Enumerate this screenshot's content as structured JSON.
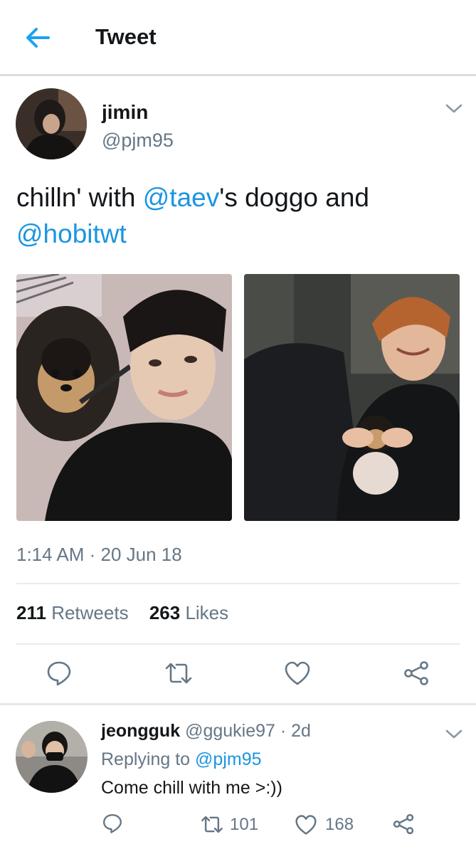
{
  "header": {
    "title": "Tweet"
  },
  "tweet": {
    "author_name": "jimin",
    "author_handle": "@pjm95",
    "text_part1": "chilln' with ",
    "mention1": "@taev",
    "text_part2": "'s doggo and ",
    "mention2": "@hobitwt",
    "timestamp": "1:14 AM · 20 Jun 18",
    "retweets_count": "211",
    "retweets_label": "Retweets",
    "likes_count": "263",
    "likes_label": "Likes"
  },
  "reply": {
    "author_name": "jeongguk",
    "author_handle": "@ggukie97",
    "time": "· 2d",
    "replying_to_label": "Replying to",
    "replying_to_handle": "@pjm95",
    "text": "Come chill with me >:))",
    "retweets": "101",
    "likes": "168"
  },
  "colors": {
    "accent": "#1b95e0",
    "secondary_text": "#657786",
    "divider": "#e6ecf0"
  }
}
